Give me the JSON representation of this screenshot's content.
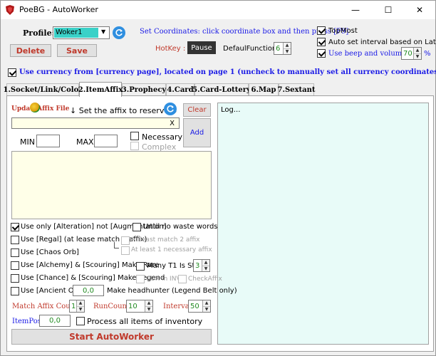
{
  "window": {
    "title": "PoeBG - AutoWorker",
    "minimize": "—",
    "maximize": "☐",
    "close": "✕"
  },
  "profile": {
    "label": "Profile:",
    "value": "Woker1"
  },
  "buttons": {
    "delete": "Delete",
    "save": "Save",
    "pause": "Pause",
    "clear": "Clear",
    "add": "Add",
    "start": "Start AutoWorker",
    "clear_x": "X"
  },
  "coords_hint": "Set Coordinates: click coordinate box and then press [F9]",
  "hotkey_label": "HotKey :",
  "default_function": {
    "label": "DefaulFunction",
    "value": "6"
  },
  "options": {
    "topmost": "TopMost",
    "auto_interval": "Auto set interval based on Latency",
    "beep_label": "Use beep and volume set",
    "beep_value": "70",
    "beep_unit": "%"
  },
  "use_currency": "Use currency from [currency page], located on page 1 (uncheck to manually set all currency coordinates)",
  "tabs": [
    {
      "label": "1.Socket/Link/Color"
    },
    {
      "label": "2.ItemAffix"
    },
    {
      "label": "3.Prophecy"
    },
    {
      "label": "4.Card"
    },
    {
      "label": "5.Card-Lottery"
    },
    {
      "label": "6.Map"
    },
    {
      "label": "7.Sextant"
    }
  ],
  "affix": {
    "update_file": "UpdateAffix File",
    "set_affix": "↓ Set the affix to reserve ↓",
    "min_label": "MIN",
    "max_label": "MAX",
    "necessary": "Necessary",
    "complex": "Complex"
  },
  "log_text": "Log...",
  "orbs": {
    "alteration": "Use only [Alteration] not [Augmentation]",
    "until_no_waste": "Until no waste words",
    "regal": "Use [Regal] (at lease match 1 affix)",
    "at_least_2": "At least match 2 affix",
    "at_least_1_nec": "At least 1 necessary affix",
    "chaos": "Use [Chaos Orb]",
    "alchemy": "Use [Alchemy] & [Scouring] Make Rare",
    "many_t1": "Many T1 Is Stop",
    "many_t1_value": "3",
    "chance": "Use [Chance] & [Scouring] Make Legend",
    "cur_inv": "CUR in INV",
    "check_affix": "CheckAffix",
    "ancient": "Use [Ancient Orb]",
    "ancient_value": "0,0",
    "headhunter": "Make headhunter (Legend Belt only)"
  },
  "counts": {
    "match_label": "Match Affix Count",
    "match_value": "1",
    "run_label": "RunCount",
    "run_value": "10",
    "interval_label": "Interval",
    "interval_value": "50"
  },
  "itempos": {
    "label": "ItemPos",
    "value": "0,0",
    "process_all": "Process all items of inventory"
  },
  "colors": {
    "accent_blue": "#1a1ae6",
    "red_text": "#c0392b",
    "profile_bg": "#3ad1c8",
    "green_text": "#228b22"
  }
}
